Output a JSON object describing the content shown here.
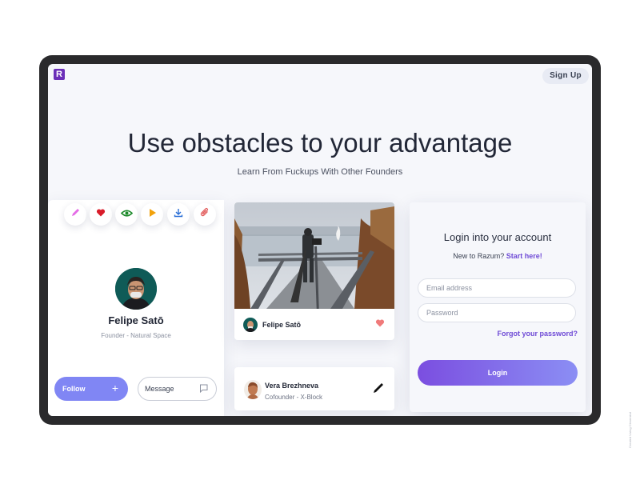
{
  "header": {
    "logo_letter": "R",
    "signup_label": "Sign Up"
  },
  "hero": {
    "title": "Use obstacles to your advantage",
    "subtitle": "Learn From Fuckups With Other Founders"
  },
  "icon_bar": [
    {
      "icon": "pencil-icon",
      "color": "#e46be6"
    },
    {
      "icon": "heart-icon",
      "color": "#d91c2a"
    },
    {
      "icon": "eye-icon",
      "color": "#1c8a2a"
    },
    {
      "icon": "play-icon",
      "color": "#f2a20c"
    },
    {
      "icon": "download-icon",
      "color": "#2b6fd6"
    },
    {
      "icon": "paperclip-icon",
      "color": "#e25a5a"
    }
  ],
  "profile": {
    "name": "Felipe Satō",
    "role": "Founder - Natural Space",
    "follow_label": "Follow",
    "follow_icon": "+",
    "message_label": "Message"
  },
  "photo_card": {
    "author": "Felipe Satō"
  },
  "contact_card": {
    "name": "Vera Brezhneva",
    "role": "Cofounder - X-Block"
  },
  "login": {
    "title": "Login into your account",
    "prompt": "New to Razum?",
    "start_link": "Start here!",
    "email_placeholder": "Email address",
    "password_placeholder": "Password",
    "forgot_label": "Forgot your password?",
    "login_label": "Login"
  },
  "colors": {
    "accent": "#8086f4",
    "brand": "#6b2fb8",
    "link": "#6f4bd6"
  },
  "credit": "Created Using Clearmind"
}
